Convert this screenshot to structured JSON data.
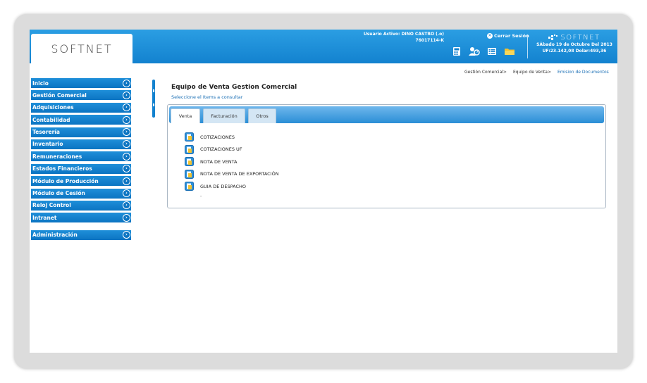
{
  "header": {
    "logo": "SOFTNET",
    "user_label": "Usuario Activo: DINO CASTRO",
    "user_suffix": "(.o)",
    "user_id": "76017114-K",
    "close_session": "Cerrar Sesión",
    "brand": "SOFTNET",
    "date": "SÁbado 19 de Octubre Del 2013",
    "uf": "UF:23.142,08 Dolar:493,36",
    "icons": [
      "calculator-icon",
      "users-icon",
      "list-icon",
      "folder-icon"
    ]
  },
  "breadcrumb": {
    "items": [
      "Gestión Comercial>",
      "Equipo de Venta>"
    ],
    "current": "Emision de Documentos"
  },
  "sidebar": {
    "items": [
      {
        "label": "Inicio"
      },
      {
        "label": "Gestión Comercial"
      },
      {
        "label": "Adquisiciones"
      },
      {
        "label": "Contabilidad"
      },
      {
        "label": "Tesorería"
      },
      {
        "label": "Inventario"
      },
      {
        "label": "Remuneraciones"
      },
      {
        "label": "Estados Financieros"
      },
      {
        "label": "Módulo de Producción"
      },
      {
        "label": "Módulo de Cesión"
      },
      {
        "label": "Reloj Control"
      },
      {
        "label": "Intranet"
      }
    ],
    "admin": "Administración",
    "arrow": "›"
  },
  "main": {
    "title": "Equipo de Venta Gestion Comercial",
    "subtitle": "Seleccione el Items a consultar",
    "tabs": [
      {
        "label": "Venta",
        "active": true
      },
      {
        "label": "Facturación",
        "active": false
      },
      {
        "label": "Otros",
        "active": false
      }
    ],
    "documents": [
      "COTIZACIONES",
      "COTIZACIONES UF",
      "NOTA DE VENTA",
      "NOTA DE VENTA DE EXPORTACIÓN",
      "GUIA DE DESPACHO"
    ],
    "dash": "-"
  },
  "colors": {
    "header_blue": "#1382cf",
    "sidebar_blue": "#0b74c2",
    "link_blue": "#1a6fb5"
  }
}
